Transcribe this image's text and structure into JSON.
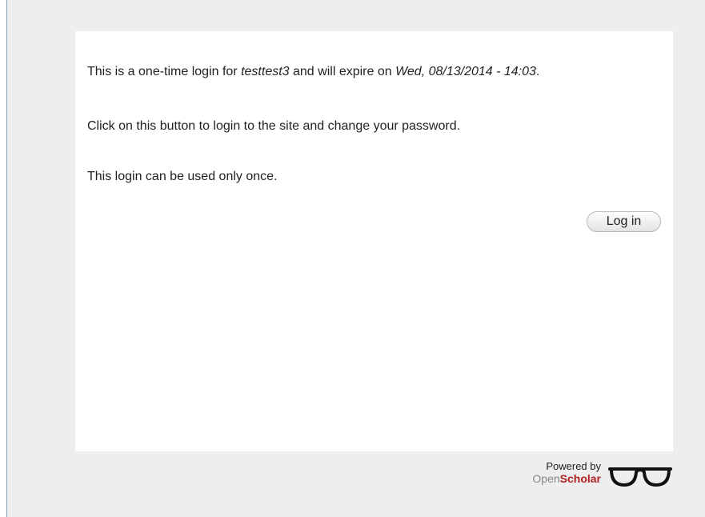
{
  "message": {
    "line1_prefix": "This is a one-time login for ",
    "username": "testtest3",
    "line1_middle": " and will expire on ",
    "expiry": "Wed, 08/13/2014 - 14:03",
    "line1_suffix": ".",
    "line2": "Click on this button to login to the site and change your password.",
    "line3": "This login can be used only once."
  },
  "login_button": {
    "label": "Log in"
  },
  "footer": {
    "powered_by": "Powered by",
    "brand_open": "Open",
    "brand_scholar": "Scholar",
    "logo_icon": "glasses-icon"
  },
  "colors": {
    "page_background": "#eeeeee",
    "panel_background": "#ffffff",
    "brand_red": "#b22222",
    "brand_gray": "#888888"
  }
}
